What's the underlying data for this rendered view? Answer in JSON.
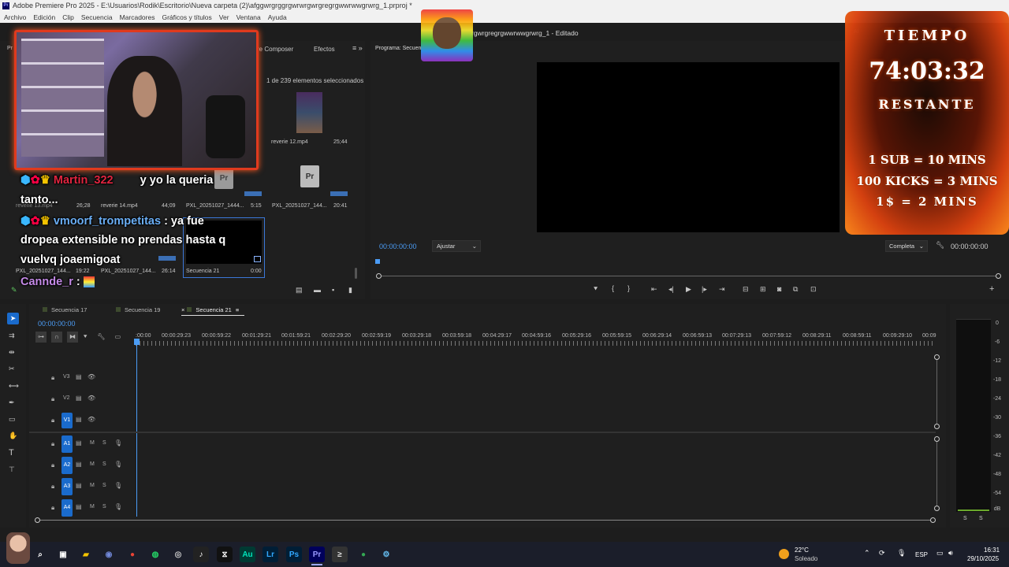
{
  "window": {
    "title": "Adobe Premiere Pro 2025 - E:\\Usuarios\\Rodik\\Escritorio\\Nueva carpeta (2)\\afggwrgrggrgwrwrgwrgregrgwwrwwgrwrg_1.prproj *",
    "menu": [
      "Archivo",
      "Edición",
      "Clip",
      "Secuencia",
      "Marcadores",
      "Gráficos y títulos",
      "Ver",
      "Ventana",
      "Ayuda"
    ]
  },
  "project_panel": {
    "tab_pr": "Pr",
    "tab_composer": "re Composer",
    "tab_effects": "Efectos",
    "selection": "1 de 239 elementos seleccionados",
    "items": [
      {
        "name": "reverie 12.mp4",
        "duration": "25;44"
      },
      {
        "name": "PXL_20251027_144...",
        "duration": "20:41"
      },
      {
        "name": "reverie 13.mp4",
        "duration": "26;28"
      },
      {
        "name": "reverie 14.mp4",
        "duration": "44;09"
      },
      {
        "name": "PXL_20251027_1444...",
        "duration": "5:15"
      },
      {
        "name": "PXL_20251027_144...",
        "duration": "19:22"
      },
      {
        "name": "PXL_20251027_144...",
        "duration": "26:14"
      },
      {
        "name": "Secuencia 21",
        "duration": "0:00"
      }
    ]
  },
  "program_monitor": {
    "tab": "Programa: Secuen",
    "title": "rgwrgregrgwwrwwgrwrg_1 - Editado",
    "timecode_left": "00:00:00:00",
    "fit": "Ajustar",
    "quality": "Completa",
    "timecode_right": "00:00:00:00",
    "side_text": "Al"
  },
  "timeline": {
    "tabs": [
      "Secuencia 17",
      "Secuencia 19",
      "Secuencia 21"
    ],
    "active_tab": "Secuencia 21",
    "timecode": "00:00:00:00",
    "ruler": [
      ":00:00",
      "00:00:29:23",
      "00:00:59:22",
      "00:01:29:21",
      "00:01:59:21",
      "00:02:29:20",
      "00:02:59:19",
      "00:03:29:18",
      "00:03:59:18",
      "00:04:29:17",
      "00:04:59:16",
      "00:05:29:16",
      "00:05:59:15",
      "00:06:29:14",
      "00:06:59:13",
      "00:07:29:13",
      "00:07:59:12",
      "00:08:29:11",
      "00:08:59:11",
      "00:09:29:10",
      "00:09"
    ],
    "video_tracks": [
      "V3",
      "V2",
      "V1"
    ],
    "audio_tracks": [
      "A1",
      "A2",
      "A3",
      "A4"
    ],
    "mute": "M",
    "solo": "S"
  },
  "meter": {
    "labels": [
      "0",
      "-6",
      "-12",
      "-18",
      "-24",
      "-30",
      "-36",
      "-42",
      "-48",
      "-54",
      "dB"
    ],
    "bottom": [
      "S",
      "S"
    ]
  },
  "overlay": {
    "chat": [
      {
        "user": "Martin_322",
        "text": "y yo la queria",
        "text2": "tanto...",
        "user_color": "#e0243f"
      },
      {
        "user": "vmoorf_trompetitas",
        "text": ": ya fue",
        "lines": [
          "dropea extensible no prendas hasta q",
          "vuelvq joaemigoat"
        ],
        "user_color": "#6aaef5"
      },
      {
        "user": "Cannde_r",
        "text": ":",
        "user_color": "#c58ae8"
      }
    ],
    "timer": {
      "label_top": "TIEMPO",
      "value": "74:03:32",
      "label_bottom": "RESTANTE",
      "rules": [
        "1 SUB = 10 MINS",
        "100 KICKS = 3 MINS",
        "1$ = 2 MINS"
      ]
    }
  },
  "taskbar": {
    "weather_temp": "22°C",
    "weather_desc": "Soleado",
    "lang": "ESP",
    "time": "16:31",
    "date": "29/10/2025",
    "apps": [
      "Au",
      "Lr",
      "Ps",
      "Pr"
    ]
  },
  "colors": {
    "accent": "#1a6bcc",
    "timecode": "#4b9cf5",
    "panel": "#232323",
    "fire": "#d9410f"
  }
}
